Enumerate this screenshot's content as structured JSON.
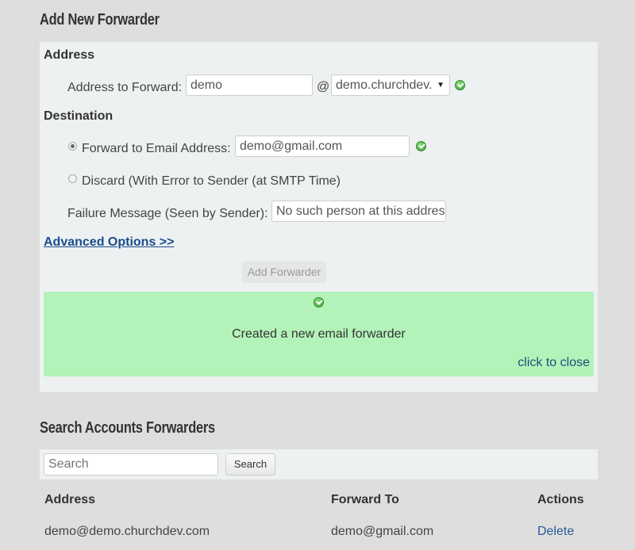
{
  "add_forwarder": {
    "title": "Add New Forwarder",
    "address_section": "Address",
    "address_label": "Address to Forward:",
    "address_value": "demo",
    "at_sign": "@",
    "domain_selected": "demo.churchdev.",
    "destination_section": "Destination",
    "forward_option_label": "Forward to Email Address:",
    "forward_option_checked": true,
    "forward_email_value": "demo@gmail.com",
    "discard_option_label": "Discard (With Error to Sender (at SMTP Time)",
    "discard_option_checked": false,
    "failure_label": "Failure Message (Seen by Sender):",
    "failure_value": "No such person at this address",
    "advanced_link": "Advanced Options >>",
    "submit_label": "Add Forwarder"
  },
  "notice": {
    "message": "Created a new email forwarder",
    "close_label": "click to close",
    "background": "#b3f3b9"
  },
  "search": {
    "title": "Search Accounts Forwarders",
    "placeholder": "Search",
    "button_label": "Search"
  },
  "table": {
    "columns": [
      "Address",
      "Forward To",
      "Actions"
    ],
    "rows": [
      {
        "address": "demo@demo.churchdev.com",
        "forward_to": "demo@gmail.com",
        "action": "Delete"
      }
    ]
  }
}
